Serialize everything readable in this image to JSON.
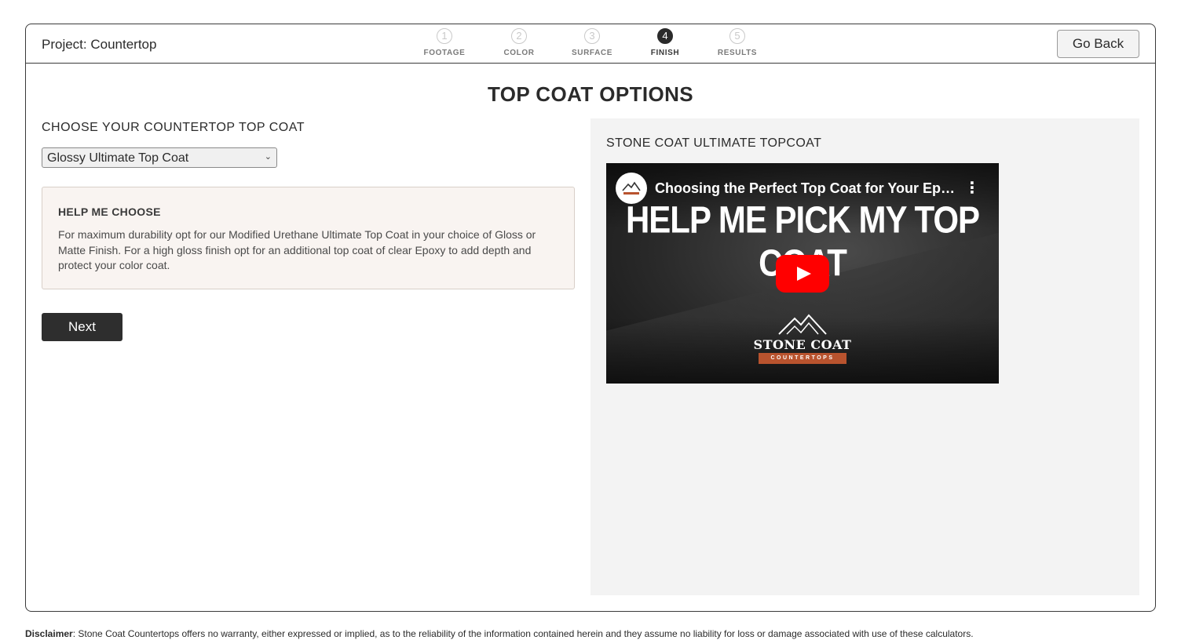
{
  "header": {
    "project_title": "Project: Countertop",
    "go_back_label": "Go Back"
  },
  "steps": [
    {
      "number": "1",
      "label": "FOOTAGE",
      "active": false
    },
    {
      "number": "2",
      "label": "COLOR",
      "active": false
    },
    {
      "number": "3",
      "label": "SURFACE",
      "active": false
    },
    {
      "number": "4",
      "label": "FINISH",
      "active": true
    },
    {
      "number": "5",
      "label": "RESULTS",
      "active": false
    }
  ],
  "main": {
    "title": "TOP COAT OPTIONS",
    "choose_label": "CHOOSE YOUR COUNTERTOP TOP COAT",
    "select_value": "Glossy Ultimate Top Coat",
    "help_title": "HELP ME CHOOSE",
    "help_text": "For maximum durability opt for our Modified Urethane Ultimate Top Coat in your choice of Gloss or Matte Finish. For a high gloss finish opt for an additional top coat of clear Epoxy to add depth and protect your color coat.",
    "next_label": "Next"
  },
  "panel": {
    "title": "STONE COAT ULTIMATE TOPCOAT",
    "video": {
      "title": "Choosing the Perfect Top Coat for Your Epoxy...",
      "menu_icon": "⋮",
      "headline": "HELP ME PICK MY TOP COAT",
      "logo_word": "STONE COAT",
      "logo_band": "COUNTERTOPS"
    }
  },
  "footer": {
    "disclaimer_label": "Disclaimer",
    "disclaimer_text": ": Stone Coat Countertops offers no warranty, either expressed or implied, as to the reliability of the information contained herein and they assume no liability for loss or damage associated with use of these calculators."
  },
  "colors": {
    "accent_dark": "#2e2e2e",
    "help_bg": "#f9f4f1",
    "panel_bg": "#f3f3f3",
    "play_red": "#ff0000",
    "brand_orange": "#b8532e"
  }
}
